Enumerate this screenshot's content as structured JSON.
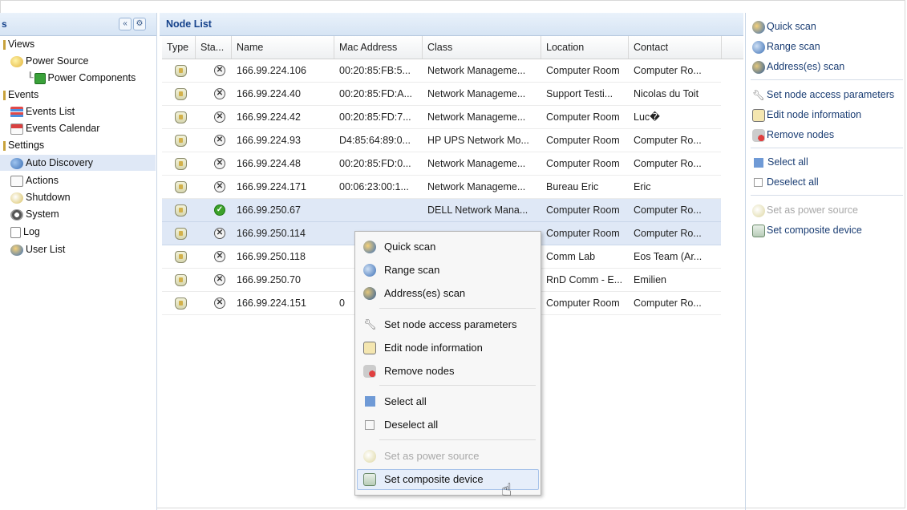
{
  "left_panel": {
    "title": "s",
    "collapse_glyph": "«",
    "gear_glyph": "⚙",
    "tree": [
      {
        "label": "Views",
        "icon": "none",
        "indent": 0
      },
      {
        "label": "Power Source",
        "icon": "power-source-icon",
        "indent": 1
      },
      {
        "label": "Power Components",
        "icon": "power-components-icon",
        "indent": 2
      },
      {
        "label": "Events",
        "icon": "none",
        "indent": 0
      },
      {
        "label": "Events List",
        "icon": "events-list-icon",
        "indent": 1
      },
      {
        "label": "Events Calendar",
        "icon": "calendar-icon",
        "indent": 1
      },
      {
        "label": "Settings",
        "icon": "none",
        "indent": 0
      },
      {
        "label": "Auto Discovery",
        "icon": "auto-discovery-icon",
        "indent": 1,
        "selected": true
      },
      {
        "label": "Actions",
        "icon": "actions-icon",
        "indent": 1
      },
      {
        "label": "Shutdown",
        "icon": "shutdown-icon",
        "indent": 1
      },
      {
        "label": "System",
        "icon": "system-gear-icon",
        "indent": 1
      },
      {
        "label": "Log",
        "icon": "log-icon",
        "indent": 1
      },
      {
        "label": "User List",
        "icon": "user-list-icon",
        "indent": 1
      }
    ]
  },
  "node_list": {
    "title": "Node List",
    "columns": [
      "Type",
      "Sta...",
      "Name",
      "Mac Address",
      "Class",
      "Location",
      "Contact"
    ],
    "rows": [
      {
        "status": "x",
        "name": "166.99.224.106",
        "mac": "00:20:85:FB:5...",
        "class": "Network Manageme...",
        "location": "Computer Room",
        "contact": "Computer Ro..."
      },
      {
        "status": "x",
        "name": "166.99.224.40",
        "mac": "00:20:85:FD:A...",
        "class": "Network Manageme...",
        "location": "Support Testi...",
        "contact": "Nicolas du Toit"
      },
      {
        "status": "x",
        "name": "166.99.224.42",
        "mac": "00:20:85:FD:7...",
        "class": "Network Manageme...",
        "location": "Computer Room",
        "contact": "Luc�"
      },
      {
        "status": "x",
        "name": "166.99.224.93",
        "mac": "D4:85:64:89:0...",
        "class": "HP UPS Network Mo...",
        "location": "Computer Room",
        "contact": "Computer Ro..."
      },
      {
        "status": "x",
        "name": "166.99.224.48",
        "mac": "00:20:85:FD:0...",
        "class": "Network Manageme...",
        "location": "Computer Room",
        "contact": "Computer Ro..."
      },
      {
        "status": "x",
        "name": "166.99.224.171",
        "mac": "00:06:23:00:1...",
        "class": "Network Manageme...",
        "location": "Bureau Eric",
        "contact": "Eric"
      },
      {
        "status": "ok",
        "name": "166.99.250.67",
        "mac": "",
        "class": "DELL Network Mana...",
        "location": "Computer Room",
        "contact": "Computer Ro...",
        "selected": true
      },
      {
        "status": "x",
        "name": "166.99.250.114",
        "mac": "",
        "class": "",
        "location": "Computer Room",
        "contact": "Computer Ro...",
        "selected": true
      },
      {
        "status": "x",
        "name": "166.99.250.118",
        "mac": "",
        "class": "",
        "location": "Comm Lab",
        "contact": "Eos Team (Ar..."
      },
      {
        "status": "x",
        "name": "166.99.250.70",
        "mac": "",
        "class": "",
        "location": "RnD Comm - E...",
        "contact": "Emilien"
      },
      {
        "status": "x",
        "name": "166.99.224.151",
        "mac": "0",
        "class": "",
        "location": "Computer Room",
        "contact": "Computer Ro..."
      }
    ]
  },
  "right_panel": {
    "actions": [
      {
        "label": "Quick scan",
        "icon": "quick-scan-icon",
        "disabled": false
      },
      {
        "label": "Range scan",
        "icon": "range-scan-icon",
        "disabled": false
      },
      {
        "label": "Address(es) scan",
        "icon": "address-scan-icon",
        "disabled": false
      },
      {
        "label": "Set node access parameters",
        "icon": "wrench-icon",
        "disabled": false
      },
      {
        "label": "Edit node information",
        "icon": "edit-pencil-icon",
        "disabled": false
      },
      {
        "label": "Remove nodes",
        "icon": "remove-icon",
        "disabled": false
      },
      {
        "label": "Select all",
        "icon": "select-all-icon",
        "disabled": false
      },
      {
        "label": "Deselect all",
        "icon": "deselect-all-icon",
        "disabled": false
      },
      {
        "label": "Set as power source",
        "icon": "power-source-icon",
        "disabled": true
      },
      {
        "label": "Set composite device",
        "icon": "composite-device-icon",
        "disabled": false
      }
    ]
  },
  "context_menu": {
    "items": [
      {
        "label": "Quick scan",
        "icon": "quick-scan-icon"
      },
      {
        "label": "Range scan",
        "icon": "range-scan-icon"
      },
      {
        "label": "Address(es) scan",
        "icon": "address-scan-icon"
      },
      {
        "label": "Set node access parameters",
        "icon": "wrench-icon"
      },
      {
        "label": "Edit node information",
        "icon": "edit-pencil-icon"
      },
      {
        "label": "Remove nodes",
        "icon": "remove-icon"
      },
      {
        "label": "Select all",
        "icon": "select-all-icon"
      },
      {
        "label": "Deselect all",
        "icon": "deselect-all-icon"
      },
      {
        "label": "Set as power source",
        "icon": "power-source-icon",
        "disabled": true
      },
      {
        "label": "Set composite device",
        "icon": "composite-device-icon",
        "hover": true
      }
    ]
  },
  "colors": {
    "header_text": "#15428b",
    "selection": "#dfe8f6",
    "link_text": "#1a3d73",
    "status_ok": "#3da12a"
  }
}
